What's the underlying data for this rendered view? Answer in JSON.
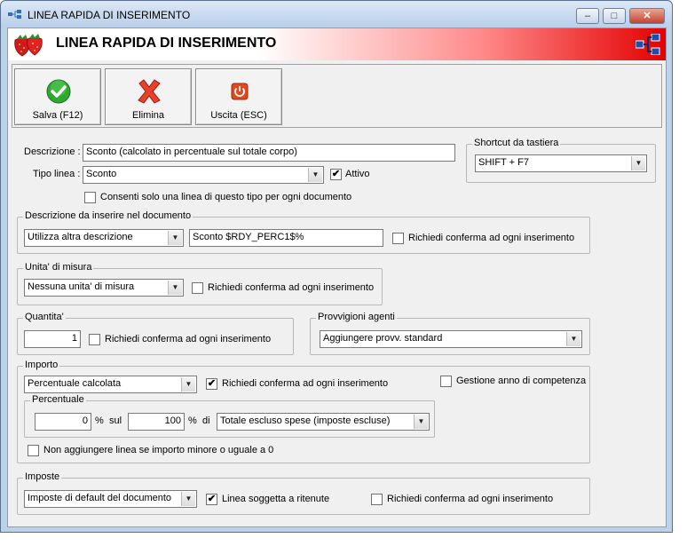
{
  "window": {
    "title": "LINEA RAPIDA DI INSERIMENTO",
    "minimize": "–",
    "maximize": "□",
    "close": "✕"
  },
  "banner": {
    "title": "LINEA RAPIDA DI INSERIMENTO",
    "gradient_end": "#e40000"
  },
  "toolbar": {
    "save_label": "Salva (F12)",
    "delete_label": "Elimina",
    "exit_label": "Uscita (ESC)",
    "icons": {
      "save": "green-check-icon",
      "delete": "red-x-icon",
      "exit": "power-icon"
    }
  },
  "form": {
    "descrizione_label": "Descrizione :",
    "descrizione_value": "Sconto (calcolato in percentuale sul totale corpo)",
    "tipo_linea_label": "Tipo linea :",
    "tipo_linea_value": "Sconto",
    "attivo_label": "Attivo",
    "attivo_checked": "✔",
    "consenti_label": "Consenti solo una linea di questo tipo per ogni documento",
    "consenti_checked": ""
  },
  "shortcut": {
    "group_label": "Shortcut da tastiera",
    "value": "SHIFT + F7"
  },
  "descrizione_doc": {
    "group_label": "Descrizione da inserire nel documento",
    "mode": "Utilizza altra descrizione",
    "text": "Sconto $RDY_PERC1$%",
    "confirm_label": "Richiedi conferma ad ogni inserimento",
    "confirm_checked": ""
  },
  "unita": {
    "group_label": "Unita' di misura",
    "value": "Nessuna unita' di misura",
    "confirm_label": "Richiedi conferma ad ogni inserimento",
    "confirm_checked": ""
  },
  "quantita": {
    "group_label": "Quantita'",
    "value": "1",
    "confirm_label": "Richiedi conferma ad ogni inserimento",
    "confirm_checked": ""
  },
  "provvigioni": {
    "group_label": "Provvigioni agenti",
    "value": "Aggiungere provv. standard"
  },
  "importo": {
    "group_label": "Importo",
    "type_value": "Percentuale calcolata",
    "confirm_label": "Richiedi conferma ad ogni inserimento",
    "confirm_checked": "✔",
    "anno_label": "Gestione anno di competenza",
    "anno_checked": "",
    "percentuale_group": "Percentuale",
    "perc_value": "0",
    "perc_symbol": "%",
    "sul_label": "sul",
    "base_value": "100",
    "di_label": "di",
    "base_type": "Totale escluso spese (imposte escluse)",
    "non_aggiungere_label": "Non aggiungere linea se importo minore o uguale a 0",
    "non_aggiungere_checked": ""
  },
  "imposte": {
    "group_label": "Imposte",
    "value": "Imposte di default del documento",
    "ritenute_label": "Linea soggetta a ritenute",
    "ritenute_checked": "✔",
    "confirm_label": "Richiedi conferma ad ogni inserimento",
    "confirm_checked": ""
  },
  "dropdown_arrow": "▼"
}
